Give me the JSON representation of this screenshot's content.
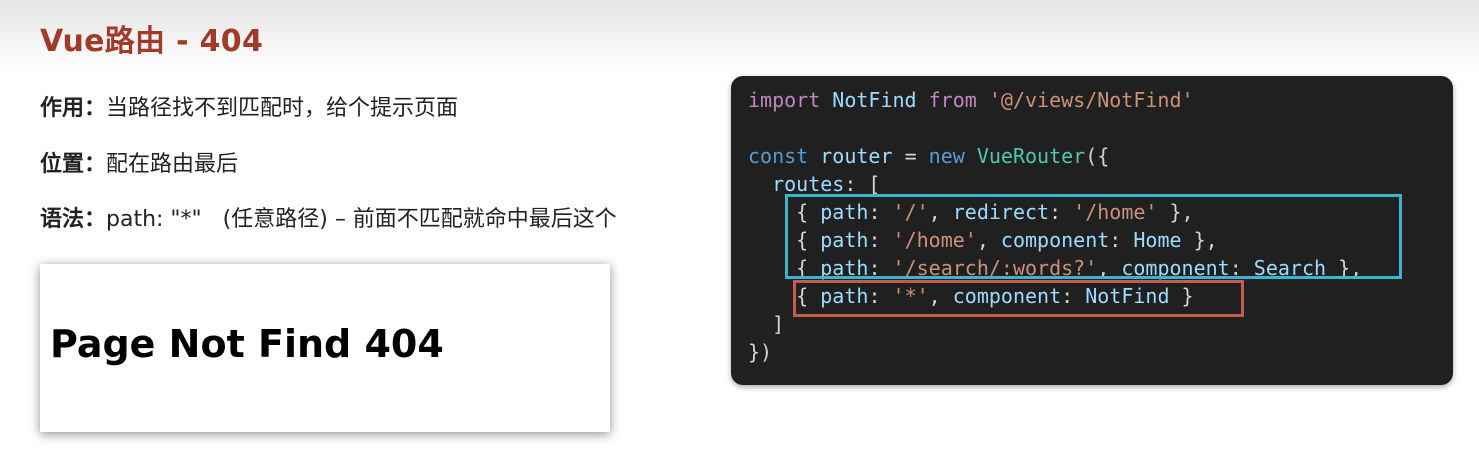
{
  "title": "Vue路由 - 404",
  "items": [
    {
      "label": "作用：",
      "text": "当路径找不到匹配时，给个提示页面"
    },
    {
      "label": "位置：",
      "text": "配在路由最后"
    },
    {
      "label": "语法：",
      "text": "path: \"*\"   (任意路径) – 前面不匹配就命中最后这个"
    }
  ],
  "preview": {
    "heading": "Page Not Find 404"
  },
  "code": {
    "l1": {
      "a": "import",
      "b": "NotFind",
      "c": "from",
      "d": "'@/views/NotFind'"
    },
    "l2": {
      "a": "const",
      "b": "router",
      "c": "=",
      "d": "new",
      "e": "VueRouter",
      "f": "({"
    },
    "l3": {
      "a": "routes",
      "b": ": ["
    },
    "l4": {
      "a": "{ ",
      "b": "path",
      "c": ": ",
      "d": "'/'",
      "e": ", ",
      "f": "redirect",
      "g": ": ",
      "h": "'/home'",
      "i": " },"
    },
    "l5": {
      "a": "{ ",
      "b": "path",
      "c": ": ",
      "d": "'/home'",
      "e": ", ",
      "f": "component",
      "g": ": ",
      "h": "Home",
      "i": " },"
    },
    "l6": {
      "a": "{ ",
      "b": "path",
      "c": ": ",
      "d": "'/search/:words?'",
      "e": ", ",
      "f": "component",
      "g": ": ",
      "h": "Search",
      "i": " },"
    },
    "l7": {
      "a": "{ ",
      "b": "path",
      "c": ": ",
      "d": "'*'",
      "e": ", ",
      "f": "component",
      "g": ": ",
      "h": "NotFind",
      "i": " }"
    },
    "l8": "]",
    "l9": "})"
  }
}
